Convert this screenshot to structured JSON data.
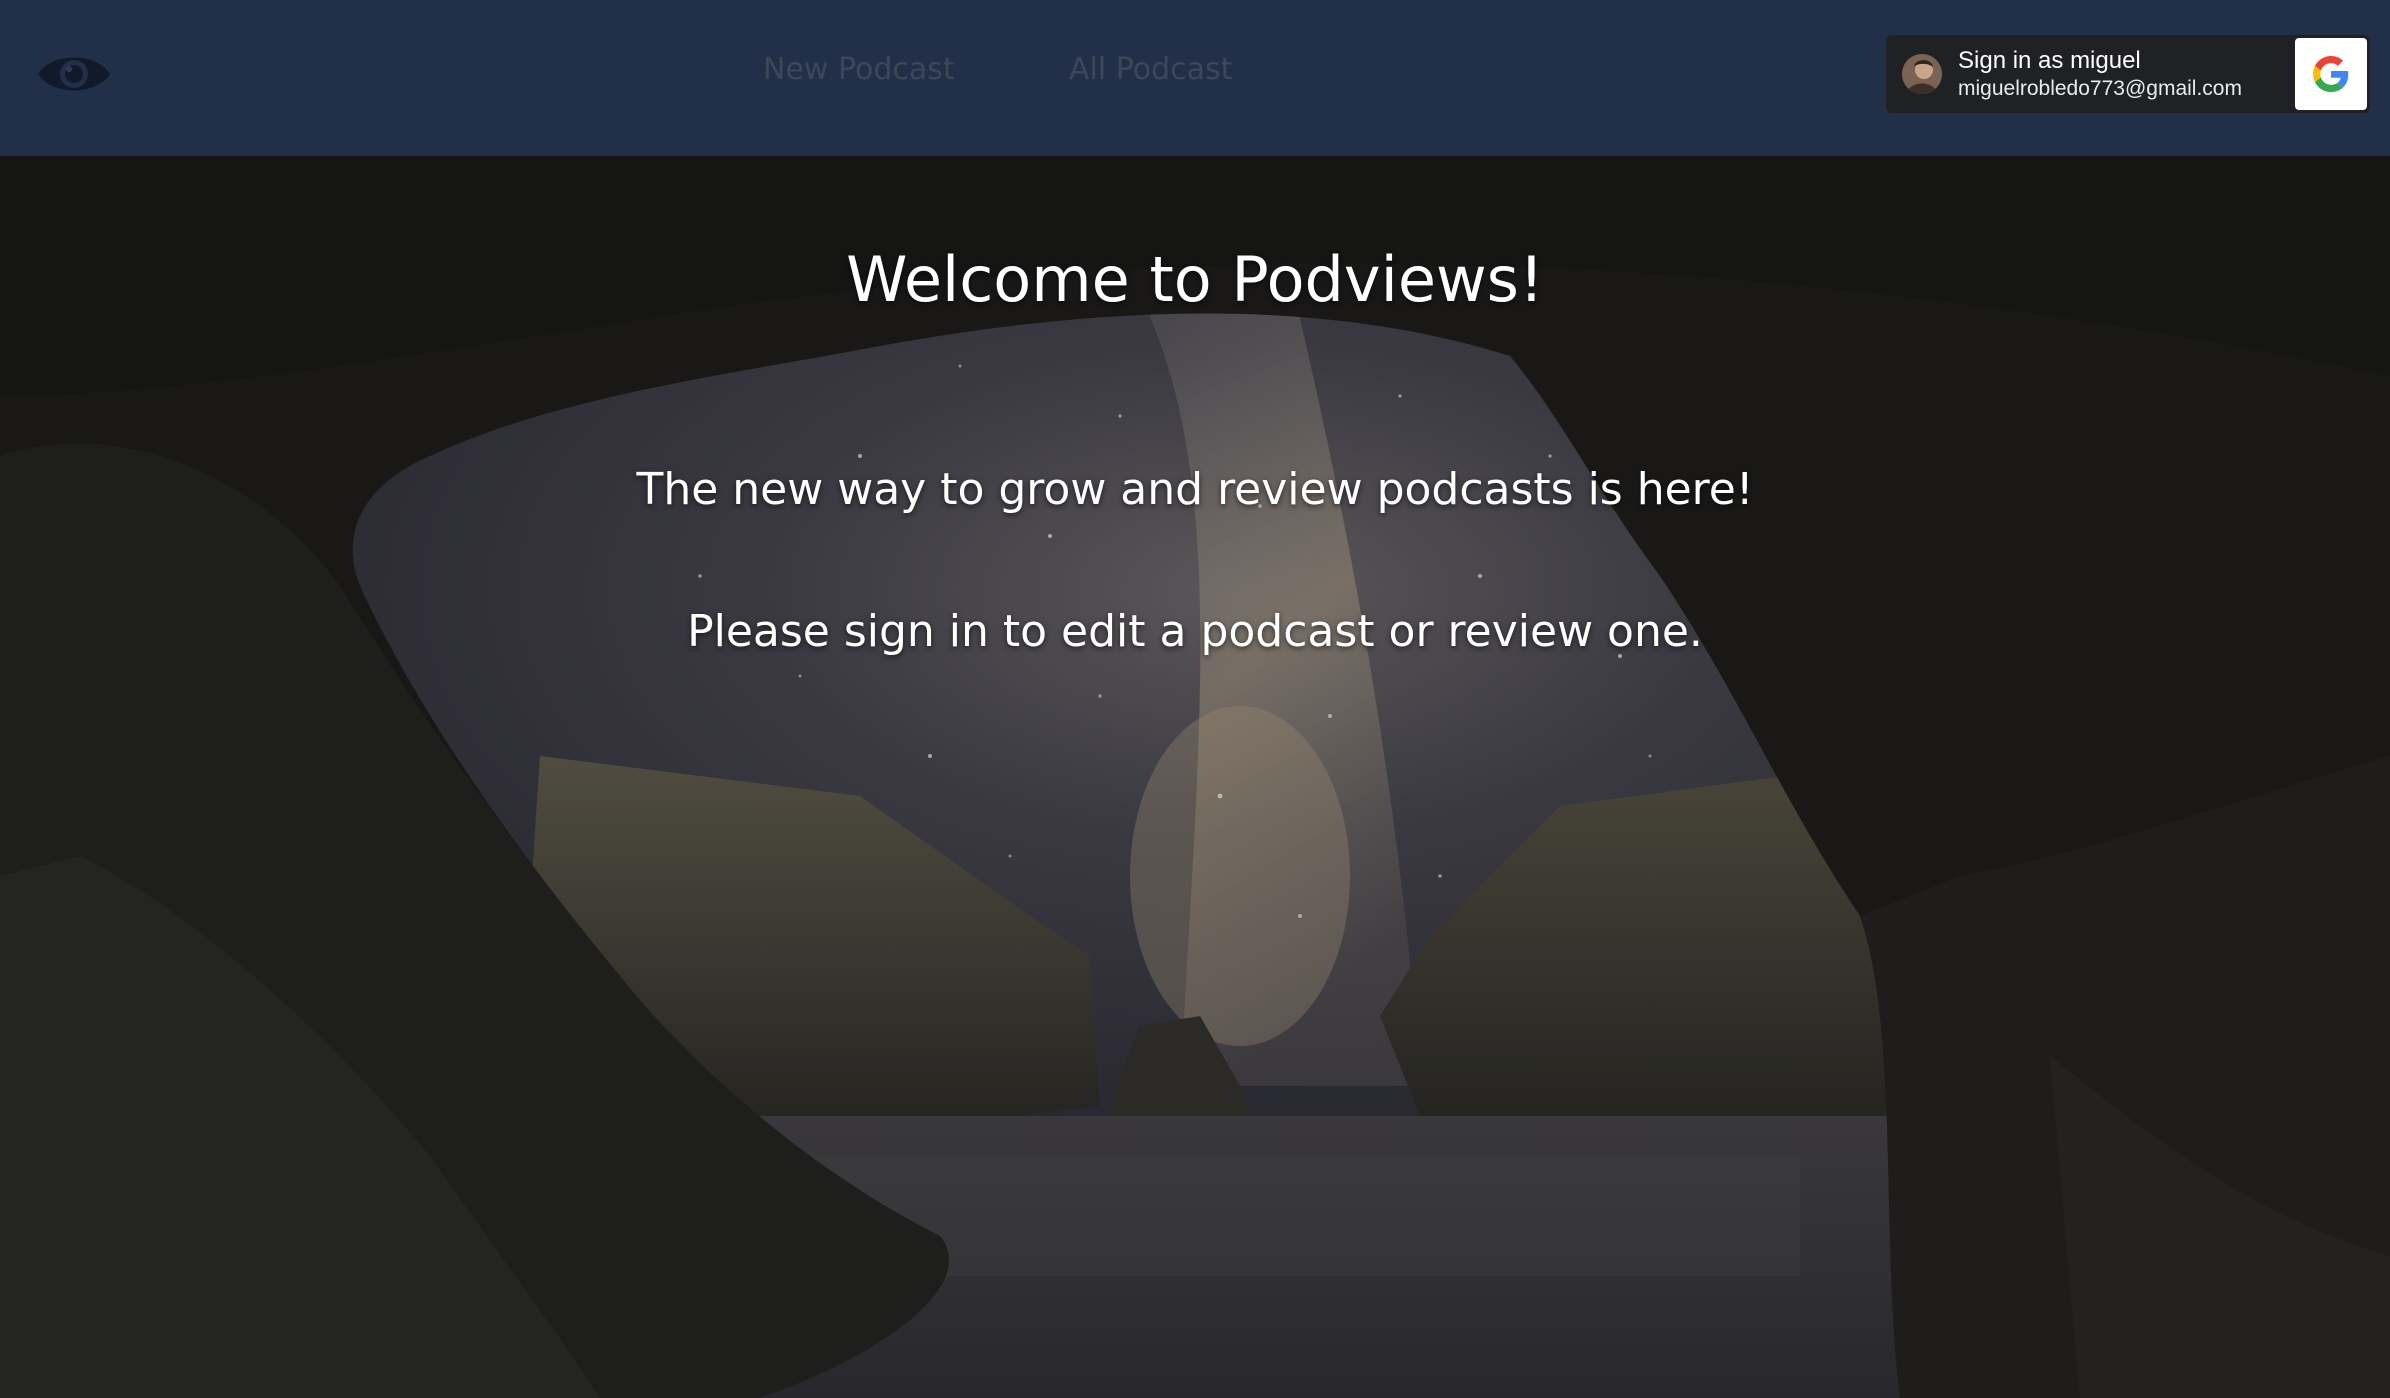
{
  "nav": {
    "logo_icon": "eye-icon",
    "links": [
      {
        "label": "New Podcast"
      },
      {
        "label": "All Podcast"
      }
    ]
  },
  "google_signin": {
    "name_line": "Sign in as miguel",
    "email": "miguelrobledo773@gmail.com",
    "icon": "google-g-icon"
  },
  "hero": {
    "title": "Welcome to Podviews!",
    "tagline": "The new way to grow and review podcasts is here!",
    "prompt": "Please sign in to edit a podcast or review one."
  },
  "colors": {
    "navbar": "#212f49",
    "nav_link": "#3d4757",
    "signin_bg": "#202124",
    "text": "#ffffff"
  }
}
